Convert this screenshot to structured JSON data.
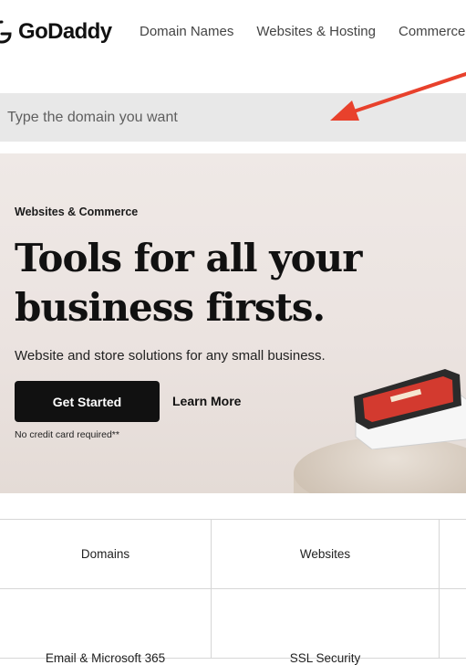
{
  "header": {
    "logo_text": "GoDaddy",
    "nav": [
      {
        "label": "Domain Names"
      },
      {
        "label": "Websites & Hosting"
      },
      {
        "label": "Commerce"
      }
    ]
  },
  "search": {
    "placeholder": "Type the domain you want"
  },
  "hero": {
    "kicker": "Websites & Commerce",
    "title": "Tools for all your business firsts.",
    "subtitle": "Website and store solutions for any small business.",
    "primary_button": "Get Started",
    "secondary_link": "Learn More",
    "note": "No credit card required**"
  },
  "categories": {
    "row1": [
      "Domains",
      "Websites",
      ""
    ],
    "row2": [
      "Email & Microsoft 365",
      "SSL Security",
      ""
    ]
  },
  "colors": {
    "arrow": "#e8412c",
    "hero_bg": "#ece5e2",
    "button_bg": "#111111",
    "search_bg": "#e8e8e8",
    "device_screen": "#d33a2f"
  },
  "icons": [
    "godaddy-logo-icon",
    "arrow-annotation-icon",
    "pos-terminal-image"
  ]
}
